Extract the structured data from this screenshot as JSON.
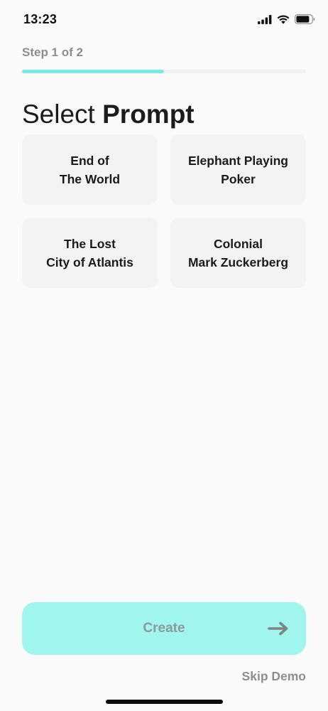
{
  "status_bar": {
    "time": "13:23",
    "icons": [
      "cellular-signal-icon",
      "wifi-icon",
      "battery-icon"
    ]
  },
  "step": {
    "label": "Step 1 of 2",
    "progress": 0.5
  },
  "heading": {
    "light": "Select",
    "bold": "Prompt"
  },
  "prompts": [
    {
      "line1": "End of",
      "line2": "The World"
    },
    {
      "line1": "Elephant Playing",
      "line2": "Poker"
    },
    {
      "line1": "The Lost",
      "line2": "City of Atlantis"
    },
    {
      "line1": "Colonial",
      "line2": "Mark Zuckerberg"
    }
  ],
  "create_button": {
    "label": "Create",
    "icon": "arrow-right-icon"
  },
  "skip_demo": "Skip Demo",
  "colors": {
    "accent": "#76ece3",
    "button_bg": "#a0f5ec",
    "background": "#fafafa",
    "card_bg": "#f3f3f3"
  }
}
